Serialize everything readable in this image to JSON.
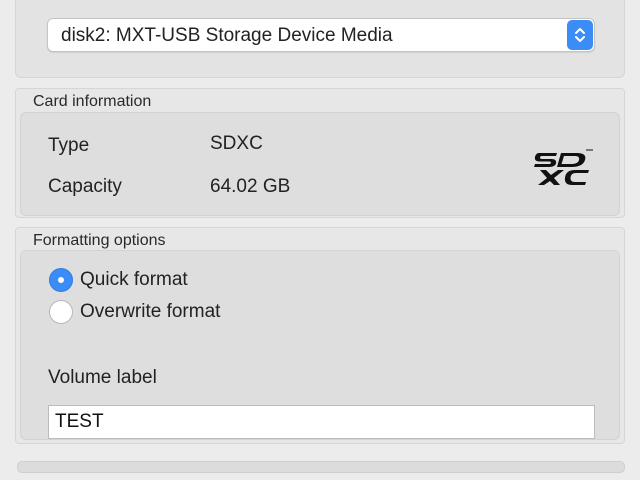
{
  "device": {
    "selected": "disk2: MXT-USB Storage Device Media"
  },
  "card_info": {
    "title": "Card information",
    "type_label": "Type",
    "type_value": "SDXC",
    "capacity_label": "Capacity",
    "capacity_value": "64.02 GB",
    "logo_text": "SDXC"
  },
  "formatting": {
    "title": "Formatting options",
    "options": [
      {
        "label": "Quick format",
        "selected": true
      },
      {
        "label": "Overwrite format",
        "selected": false
      }
    ],
    "volume_label": "Volume label",
    "volume_value": "TEST"
  },
  "colors": {
    "accent": "#3b8cf5",
    "panel": "#e3e3e3",
    "background": "#ececec"
  }
}
